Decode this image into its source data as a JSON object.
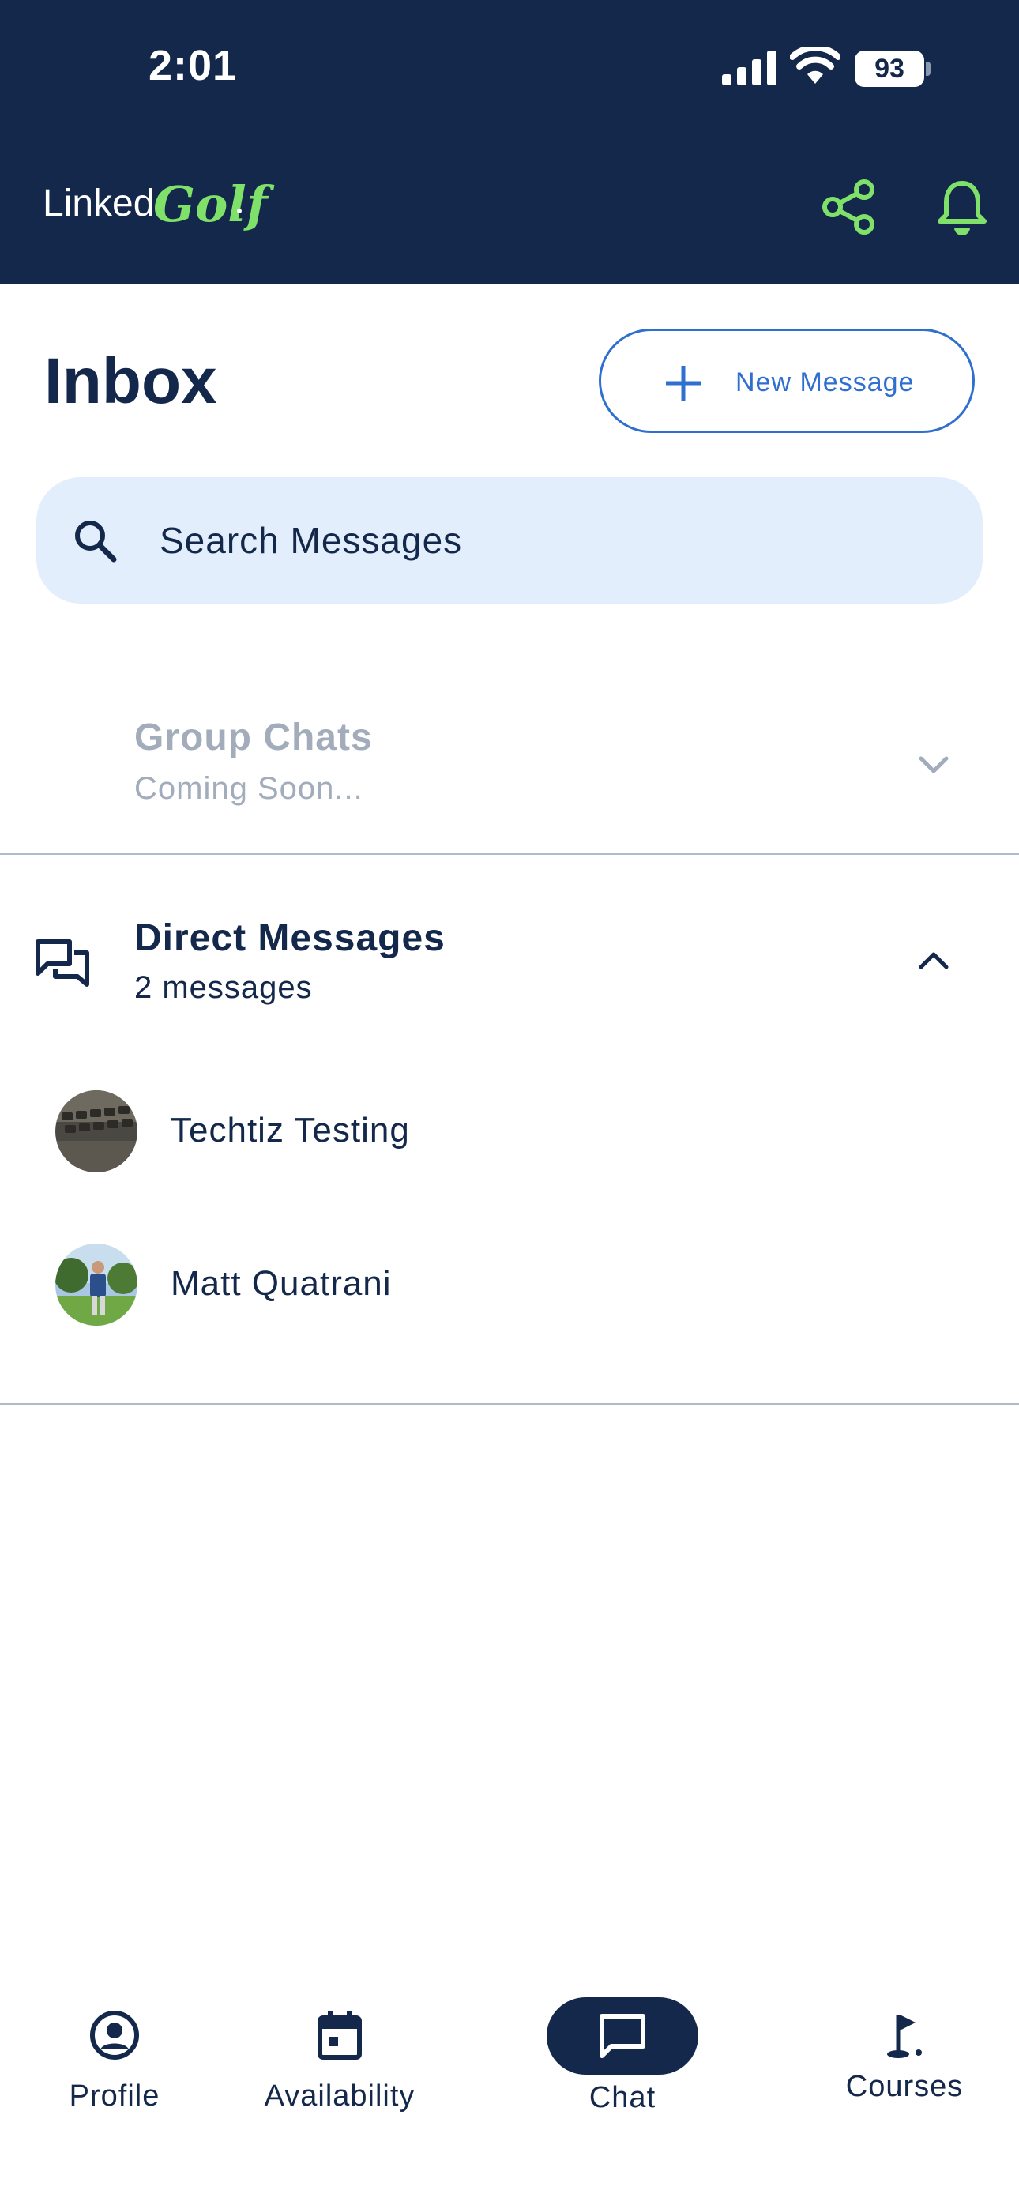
{
  "status_bar": {
    "time": "2:01",
    "battery": "93"
  },
  "app_bar": {
    "logo_linked": "Linked",
    "logo_golf": "Golf",
    "accent_color": "#7fe06a",
    "bg_color": "#13284a"
  },
  "inbox": {
    "title": "Inbox",
    "new_message_label": "New Message",
    "search_placeholder": "Search Messages"
  },
  "group_chats": {
    "title": "Group Chats",
    "subtitle": "Coming Soon..."
  },
  "direct_messages": {
    "title": "Direct Messages",
    "count": "2 messages",
    "contacts": [
      {
        "name": "Techtiz Testing",
        "avatar": "keyboard-photo"
      },
      {
        "name": "Matt Quatrani",
        "avatar": "golfer-photo"
      }
    ]
  },
  "bottom_nav": {
    "items": [
      {
        "label": "Profile",
        "icon": "user-circle-icon"
      },
      {
        "label": "Availability",
        "icon": "calendar-icon"
      },
      {
        "label": "Chat",
        "icon": "chat-bubble-icon",
        "active": true
      },
      {
        "label": "Courses",
        "icon": "golf-flag-icon"
      }
    ]
  }
}
